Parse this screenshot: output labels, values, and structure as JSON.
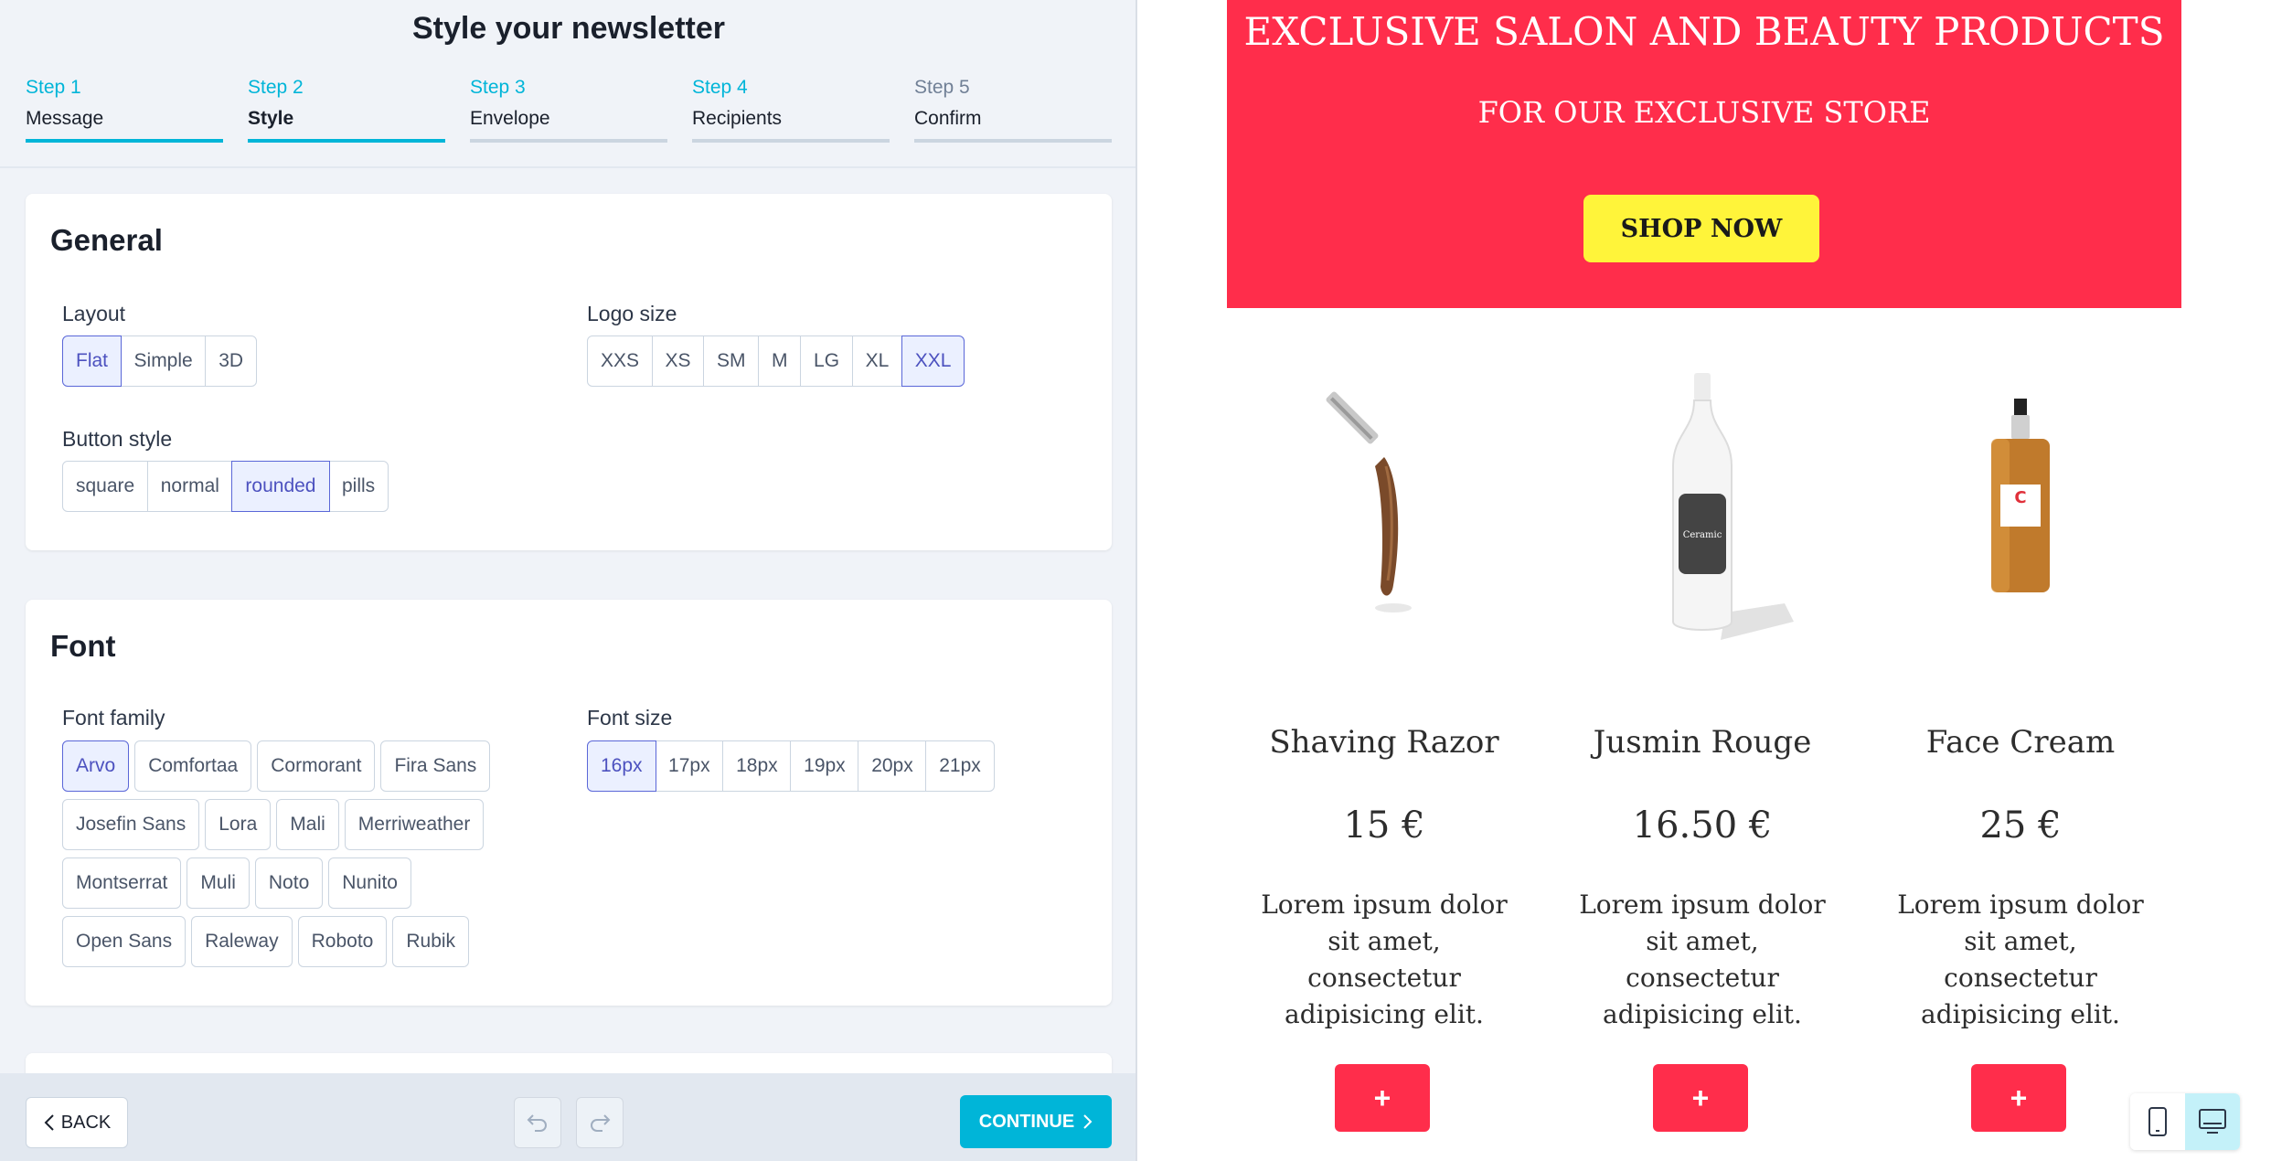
{
  "header": {
    "title": "Style your newsletter"
  },
  "steps": [
    {
      "num": "Step 1",
      "label": "Message"
    },
    {
      "num": "Step 2",
      "label": "Style"
    },
    {
      "num": "Step 3",
      "label": "Envelope"
    },
    {
      "num": "Step 4",
      "label": "Recipients"
    },
    {
      "num": "Step 5",
      "label": "Confirm"
    }
  ],
  "general": {
    "title": "General",
    "layout_label": "Layout",
    "layout_options": [
      "Flat",
      "Simple",
      "3D"
    ],
    "layout_selected": "Flat",
    "logo_label": "Logo size",
    "logo_options": [
      "XXS",
      "XS",
      "SM",
      "M",
      "LG",
      "XL",
      "XXL"
    ],
    "logo_selected": "XXL",
    "button_label": "Button style",
    "button_options": [
      "square",
      "normal",
      "rounded",
      "pills"
    ],
    "button_selected": "rounded"
  },
  "font": {
    "title": "Font",
    "family_label": "Font family",
    "families": [
      "Arvo",
      "Comfortaa",
      "Cormorant",
      "Fira Sans",
      "Josefin Sans",
      "Lora",
      "Mali",
      "Merriweather",
      "Montserrat",
      "Muli",
      "Noto",
      "Nunito",
      "Open Sans",
      "Raleway",
      "Roboto",
      "Rubik"
    ],
    "family_selected": "Arvo",
    "size_label": "Font size",
    "sizes": [
      "16px",
      "17px",
      "18px",
      "19px",
      "20px",
      "21px"
    ],
    "size_selected": "16px"
  },
  "footer": {
    "back_label": "BACK",
    "continue_label": "CONTINUE"
  },
  "preview": {
    "hero_title": "EXCLUSIVE SALON AND BEAUTY PRODUCTS",
    "hero_subtitle": "FOR OUR EXCLUSIVE STORE",
    "shop_button": "SHOP NOW",
    "products": [
      {
        "name": "Shaving Razor",
        "price": "15 €",
        "desc": "Lorem ipsum dolor sit amet, consectetur adipisicing elit.",
        "button": "+"
      },
      {
        "name": "Jusmin Rouge",
        "price": "16.50 €",
        "desc": "Lorem ipsum dolor sit amet, consectetur adipisicing elit.",
        "button": "+"
      },
      {
        "name": "Face Cream",
        "price": "25 €",
        "desc": "Lorem ipsum dolor sit amet, consectetur adipisicing elit.",
        "button": "+"
      }
    ],
    "bottle_label": "Ceramic",
    "cream_label": "C"
  },
  "colors": {
    "accent": "#00b5d8",
    "hero": "#ff2d4b",
    "shop_button": "#fff43a",
    "selected": "#5a67d8"
  },
  "icons": {
    "mobile": "mobile-icon",
    "desktop": "desktop-icon",
    "undo": "undo-icon",
    "redo": "redo-icon"
  }
}
